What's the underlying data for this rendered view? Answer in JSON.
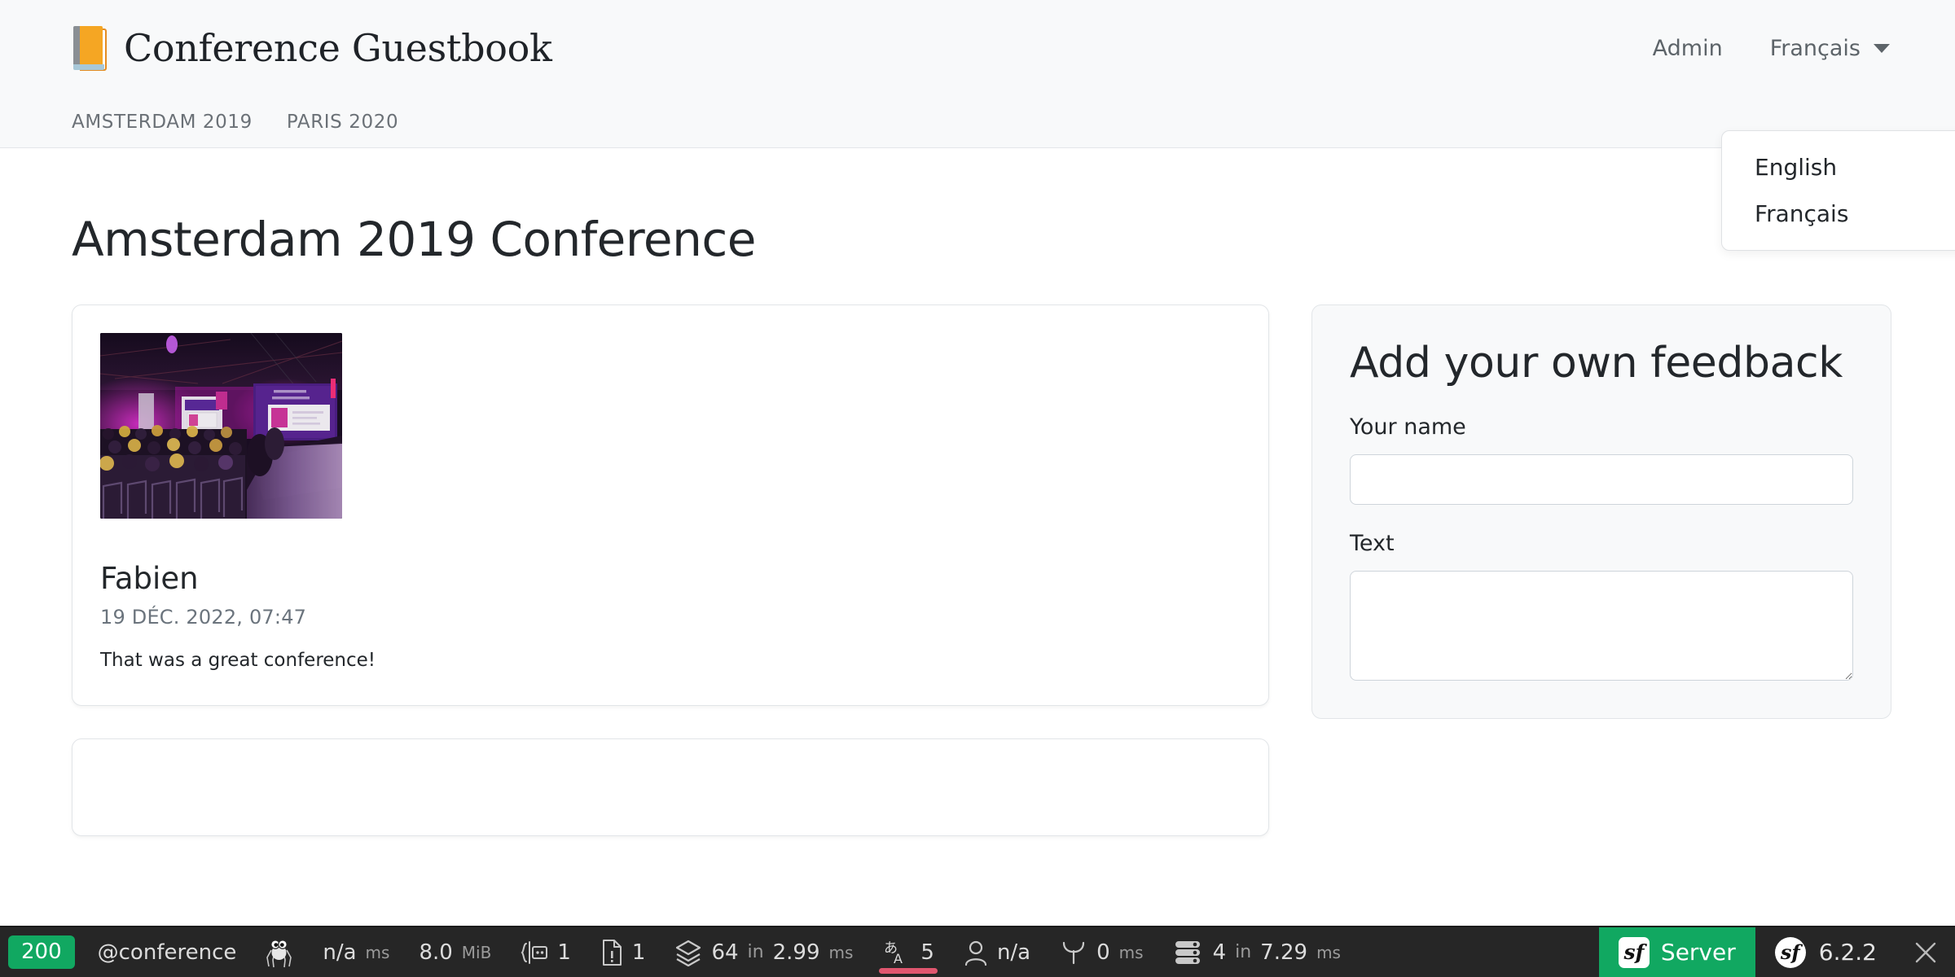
{
  "header": {
    "brand_title": "Conference Guestbook",
    "logo_icon": "notebook-icon",
    "admin_label": "Admin",
    "language_current": "Français",
    "caret_icon": "chevron-down-icon",
    "nav_tabs": [
      {
        "label": "AMSTERDAM 2019"
      },
      {
        "label": "PARIS 2020"
      }
    ],
    "language_menu": [
      {
        "label": "English"
      },
      {
        "label": "Français"
      }
    ]
  },
  "main": {
    "page_title": "Amsterdam 2019 Conference",
    "comments": [
      {
        "author": "Fabien",
        "date": "19 DÉC. 2022, 07:47",
        "text": "That was a great conference!",
        "photo_alt": "conference-hall-photo"
      }
    ],
    "form": {
      "title": "Add your own feedback",
      "name_label": "Your name",
      "name_value": "",
      "name_placeholder": "",
      "text_label": "Text",
      "text_value": "",
      "text_placeholder": ""
    }
  },
  "toolbar": {
    "status_code": "200",
    "route": "@conference",
    "profiler_icon": "symfony-bug-icon",
    "time_value": "n/a",
    "time_unit": "ms",
    "memory_value": "8.0",
    "memory_unit": "MiB",
    "forms_icon": "forms-icon",
    "forms_count": "1",
    "logs_icon": "logs-icon",
    "logs_count": "1",
    "twig_icon": "twig-layers-icon",
    "twig_count": "64",
    "twig_in": "in",
    "twig_time": "2.99",
    "twig_unit": "ms",
    "translation_icon": "translation-icon",
    "translation_count": "5",
    "translation_alert_color": "#e0566f",
    "security_icon": "user-icon",
    "security_value": "n/a",
    "cache_icon": "sprout-icon",
    "cache_value": "0",
    "cache_unit": "ms",
    "db_icon": "database-icon",
    "db_count": "4",
    "db_in": "in",
    "db_time": "7.29",
    "db_unit": "ms",
    "server_label": "Server",
    "server_logo": "symfony-logo-icon",
    "version": "6.2.2",
    "version_logo": "symfony-logo-icon",
    "close_icon": "close-icon",
    "accent_green": "#11a861",
    "background": "#262626"
  }
}
